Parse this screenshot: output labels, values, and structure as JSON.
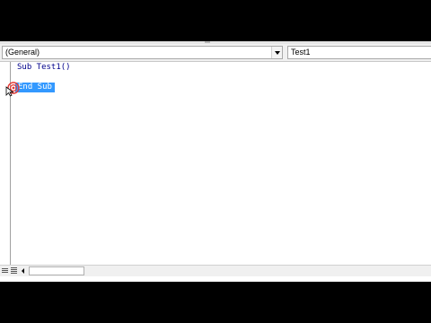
{
  "editor": {
    "object_combo": {
      "value": "(General)",
      "icon": "chevron-down-icon"
    },
    "procedure_combo": {
      "value": "Test1"
    },
    "code_lines": [
      "Sub Test1()",
      "End Sub"
    ],
    "selection_color": "#3399ff",
    "keyword_color": "#00008b"
  },
  "footer": {
    "view_buttons": [
      "procedure-view-icon",
      "full-module-view-icon"
    ],
    "scroll_left_icon": "arrow-left-icon"
  },
  "overlay": {
    "click_indicator": "click-ripple-icon",
    "cursor": "mouse-pointer-icon"
  }
}
